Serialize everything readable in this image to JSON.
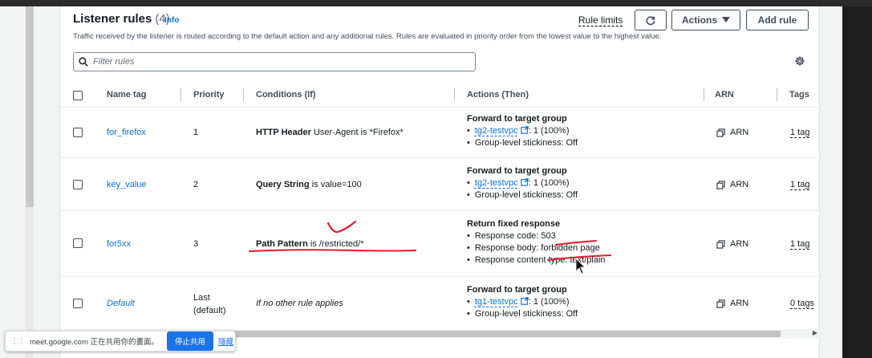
{
  "header": {
    "title": "Listener rules",
    "count": "(4)",
    "info": "Info",
    "description": "Traffic received by the listener is routed according to the default action and any additional rules. Rules are evaluated in priority order from the lowest value to the highest value.",
    "rule_limits": "Rule limits",
    "actions_label": "Actions",
    "add_rule_label": "Add rule"
  },
  "filter": {
    "placeholder": "Filter rules"
  },
  "columns": [
    "Name tag",
    "Priority",
    "Conditions (If)",
    "Actions (Then)",
    "ARN",
    "Tags"
  ],
  "rows": [
    {
      "name": "for_firefox",
      "priority": "1",
      "cond_bold": "HTTP Header",
      "cond_rest": "User-Agent is *Firefox*",
      "action_title": "Forward to target group",
      "tg_link": "tg2-testvpc",
      "tg_rest": ": 1 (100%)",
      "stickiness": "Group-level stickiness: Off",
      "arn": "ARN",
      "tags": "1 tag"
    },
    {
      "name": "key_value",
      "priority": "2",
      "cond_bold": "Query String",
      "cond_rest": "is value=100",
      "action_title": "Forward to target group",
      "tg_link": "tg2-testvpc",
      "tg_rest": ": 1 (100%)",
      "stickiness": "Group-level stickiness: Off",
      "arn": "ARN",
      "tags": "1 tag"
    },
    {
      "name": "for5xx",
      "priority": "3",
      "cond_bold": "Path Pattern",
      "cond_rest": "is /restricted/*",
      "action_title": "Return fixed response",
      "resp_code": "Response code: 503",
      "resp_body": "Response body: forbidden page",
      "resp_type": "Response content type: text/plain",
      "arn": "ARN",
      "tags": "1 tag"
    },
    {
      "name": "Default",
      "priority_line1": "Last",
      "priority_line2": "(default)",
      "condition": "If no other rule applies",
      "action_title": "Forward to target group",
      "tg_link": "tg1-testvpc",
      "tg_rest": ": 1 (100%)",
      "stickiness": "Group-level stickiness: Off",
      "arn": "ARN",
      "tags": "0 tags"
    }
  ],
  "meet_bar": {
    "text": "meet.google.com 正在共用你的畫面。",
    "stop_label": "停止共用",
    "hide_label": "隱藏"
  },
  "colors": {
    "link": "#0972d3",
    "annotation": "#e4182b",
    "meet_button": "#1a73e8"
  }
}
